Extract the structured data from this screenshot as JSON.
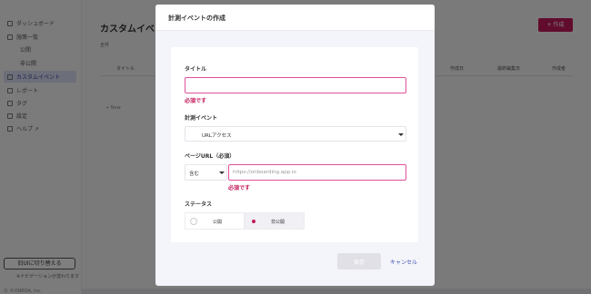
{
  "sidebar": {
    "items": [
      {
        "label": "ダッシュボード",
        "icon": "home-icon"
      },
      {
        "label": "施策一覧",
        "icon": "folder-icon"
      },
      {
        "label": "公開"
      },
      {
        "label": "非公開"
      },
      {
        "label": "カスタムイベント",
        "icon": "check-icon"
      },
      {
        "label": "レポート",
        "icon": "chart-icon"
      },
      {
        "label": "タグ",
        "icon": "code-icon"
      },
      {
        "label": "設定",
        "icon": "gear-icon"
      },
      {
        "label": "ヘルプ ↗",
        "icon": "help-icon"
      }
    ],
    "switch_ui": "旧UIに切り替える",
    "switch_note": "※ナビゲーションが変わります",
    "copyright": "© ©ONBOA, Inc."
  },
  "main": {
    "title": "カスタムイベ",
    "subtitle": "全件",
    "create_button": "+ 作成",
    "columns": [
      "タイトル",
      "作成日",
      "最終編集日",
      "作成者"
    ],
    "add_row": "+ New"
  },
  "modal": {
    "title": "計測イベントの作成",
    "title_label": "タイトル",
    "title_value": "",
    "title_error": "必須です",
    "event_label": "計測イベント",
    "event_value": "URLアクセス",
    "page_url_label": "ページURL（必須）",
    "match_value": "含む",
    "url_placeholder": "https://onboarding.app.io",
    "url_error": "必須です",
    "status_label": "ステータス",
    "status_options": [
      "公開",
      "非公開"
    ],
    "status_selected": "非公開",
    "save_label": "保存",
    "cancel_label": "キャンセル"
  },
  "colors": {
    "accent": "#c2185b",
    "link": "#3f51b5",
    "error": "#c2185b"
  }
}
